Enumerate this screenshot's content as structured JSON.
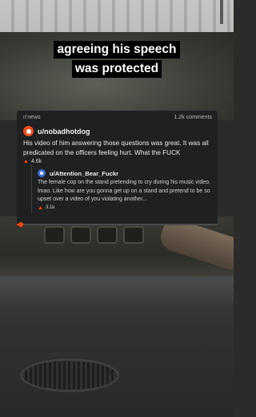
{
  "caption": {
    "line1": "agreeing his speech",
    "line2": "was protected"
  },
  "card": {
    "source_icon": "reddit-icon",
    "source": "news",
    "comments": "1.2k comments",
    "post": {
      "avatar_icon": "reddit-avatar-icon",
      "username": "u/nobadhotdog",
      "body": "His video of him answering those questions was great. It was all predicated on the officers feeling hurt. What the FUCK",
      "score": "4.6k",
      "upvote_icon": "upvote-arrow-icon"
    },
    "reply": {
      "avatar_icon": "reddit-avatar-icon",
      "username": "u/Attention_Bear_Fuckr",
      "body": "The female cop on the stand pretending to cry during his music video, lmao. Like how are you gonna get up on a stand and pretend to be so upset over a video of you violating another...",
      "score": "3.1k",
      "upvote_icon": "upvote-arrow-icon"
    }
  },
  "progress": {
    "fraction": 0.02
  },
  "colors": {
    "accent": "#ff4500",
    "card_bg": "#1f2021",
    "caption_bg": "#000000"
  }
}
